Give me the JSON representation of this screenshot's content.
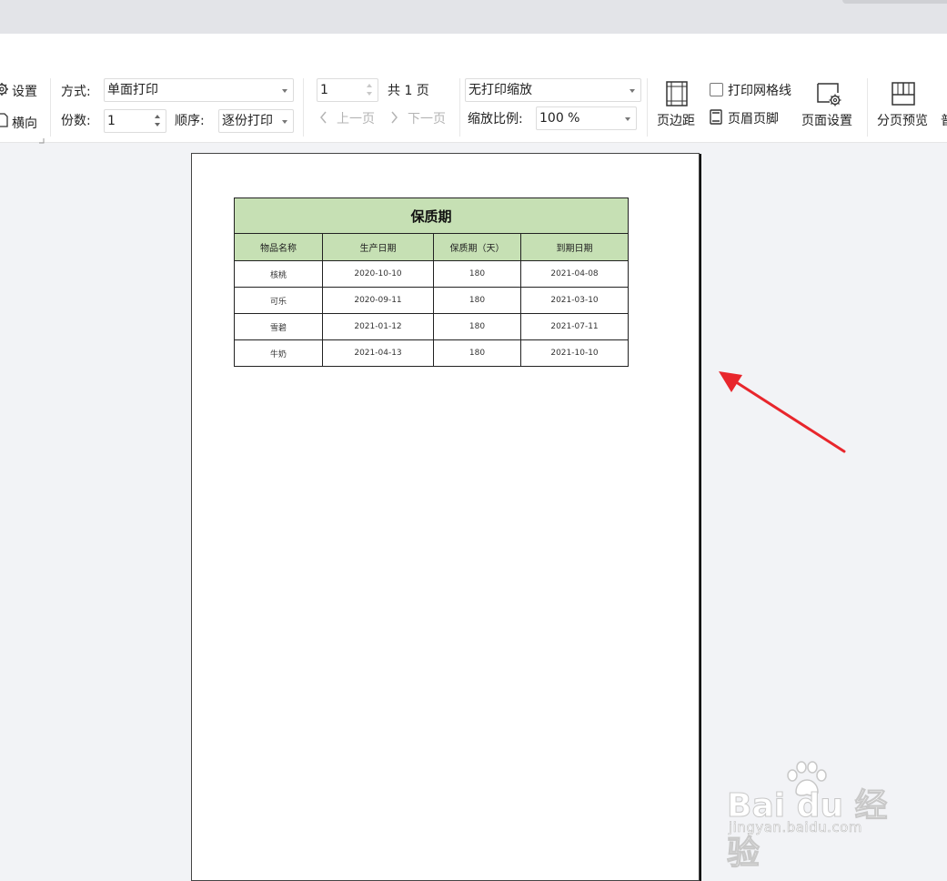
{
  "ribbon": {
    "settings_label": "设置",
    "landscape_label": "横向",
    "mode_label": "方式:",
    "mode_value": "单面打印",
    "copies_label": "份数:",
    "copies_value": "1",
    "order_label": "顺序:",
    "order_value": "逐份打印",
    "page_input_value": "1",
    "total_pages": "共 1 页",
    "prev_page": "上一页",
    "next_page": "下一页",
    "scale_mode_value": "无打印缩放",
    "zoom_label": "缩放比例:",
    "zoom_value": "100 %",
    "margins_label": "页边距",
    "gridlines_label": "打印网格线",
    "header_footer_label": "页眉页脚",
    "page_setup_label": "页面设置",
    "page_break_preview_label": "分页预览",
    "cut_off_label": "普"
  },
  "sheet": {
    "title": "保质期",
    "headers": [
      "物品名称",
      "生产日期",
      "保质期（天）",
      "到期日期"
    ],
    "rows": [
      [
        "核桃",
        "2020-10-10",
        "180",
        "2021-04-08"
      ],
      [
        "可乐",
        "2020-09-11",
        "180",
        "2021-03-10"
      ],
      [
        "雪碧",
        "2021-01-12",
        "180",
        "2021-07-11"
      ],
      [
        "牛奶",
        "2021-04-13",
        "180",
        "2021-10-10"
      ]
    ],
    "header_fill": "#c6e0b4"
  },
  "watermark": {
    "brand": "Bai du 经验",
    "url": "jingyan.baidu.com"
  },
  "annotation": {
    "arrow_color": "#e8262c"
  }
}
